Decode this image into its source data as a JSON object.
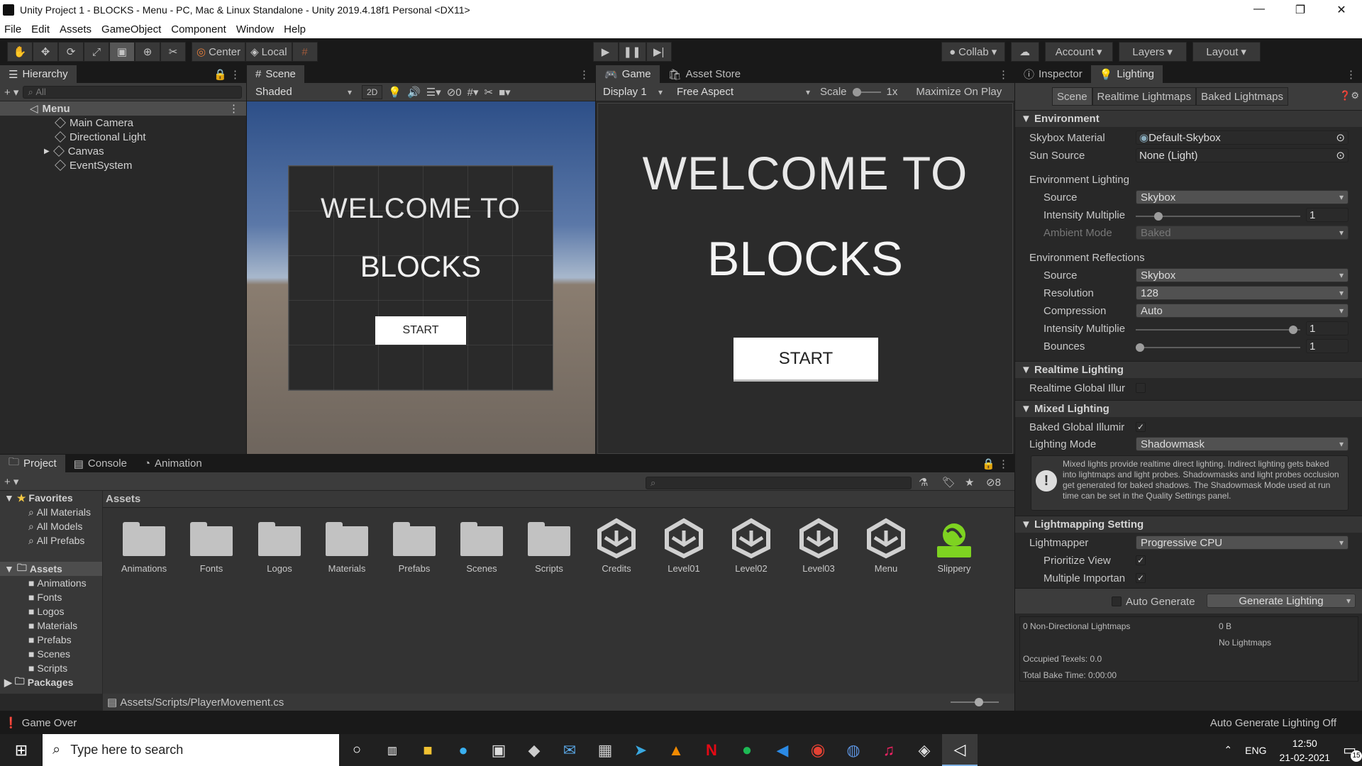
{
  "window": {
    "title": "Unity Project 1 - BLOCKS - Menu - PC, Mac & Linux Standalone - Unity 2019.4.18f1 Personal <DX11>"
  },
  "menu": [
    "File",
    "Edit",
    "Assets",
    "GameObject",
    "Component",
    "Window",
    "Help"
  ],
  "toolbar": {
    "center_label": "Center",
    "local_label": "Local",
    "collab_label": "Collab",
    "account_label": "Account",
    "layers_label": "Layers",
    "layout_label": "Layout"
  },
  "hierarchy": {
    "tab": "Hierarchy",
    "search_placeholder": "All",
    "scene": "Menu",
    "items": [
      "Main Camera",
      "Directional Light",
      "Canvas",
      "EventSystem"
    ]
  },
  "scene_view": {
    "tab": "Scene",
    "shading": "Shaded",
    "mode_2d": "2D",
    "hidden_count": "0",
    "welcome": "WELCOME TO",
    "title": "BLOCKS",
    "button": "START"
  },
  "game_view": {
    "tab": "Game",
    "asset_store_tab": "Asset Store",
    "display": "Display 1",
    "aspect": "Free Aspect",
    "scale_label": "Scale",
    "scale_value": "1x",
    "maximize": "Maximize On Play",
    "welcome": "WELCOME TO",
    "title": "BLOCKS",
    "button": "START"
  },
  "inspector": {
    "tab_inspector": "Inspector",
    "tab_lighting": "Lighting",
    "subtabs": [
      "Scene",
      "Realtime Lightmaps",
      "Baked Lightmaps"
    ],
    "environment": {
      "header": "Environment",
      "skybox_label": "Skybox Material",
      "skybox_value": "Default-Skybox",
      "sun_label": "Sun Source",
      "sun_value": "None (Light)",
      "env_lighting": "Environment Lighting",
      "source_label": "Source",
      "source_value": "Skybox",
      "intensity_label": "Intensity Multiplie",
      "intensity_value": "1",
      "ambient_label": "Ambient Mode",
      "ambient_value": "Baked",
      "env_reflections": "Environment Reflections",
      "refl_source_label": "Source",
      "refl_source_value": "Skybox",
      "resolution_label": "Resolution",
      "resolution_value": "128",
      "compression_label": "Compression",
      "compression_value": "Auto",
      "refl_intensity_label": "Intensity Multiplie",
      "refl_intensity_value": "1",
      "bounces_label": "Bounces",
      "bounces_value": "1"
    },
    "realtime": {
      "header": "Realtime Lighting",
      "gi_label": "Realtime Global Illur"
    },
    "mixed": {
      "header": "Mixed Lighting",
      "baked_label": "Baked Global Illumir",
      "mode_label": "Lighting Mode",
      "mode_value": "Shadowmask",
      "info": "Mixed lights provide realtime direct lighting. Indirect lighting gets baked into lightmaps and light probes. Shadowmasks and light probes occlusion get generated for baked shadows. The Shadowmask Mode used at run time can be set in the Quality Settings panel."
    },
    "lightmapping": {
      "header": "Lightmapping Setting",
      "lightmapper_label": "Lightmapper",
      "lightmapper_value": "Progressive CPU",
      "prioritize_label": "Prioritize View",
      "multiple_label": "Multiple Importan"
    },
    "auto_generate": "Auto Generate",
    "generate_button": "Generate Lighting",
    "stats": {
      "lightmaps": "0 Non-Directional Lightmaps",
      "size": "0 B",
      "no_lightmaps": "No Lightmaps",
      "texels": "Occupied Texels: 0.0",
      "bake_time": "Total Bake Time: 0:00:00"
    }
  },
  "project": {
    "tabs": [
      "Project",
      "Console",
      "Animation"
    ],
    "hidden_count": "8",
    "favorites": "Favorites",
    "fav_items": [
      "All Materials",
      "All Models",
      "All Prefabs"
    ],
    "assets_label": "Assets",
    "folders": [
      "Animations",
      "Fonts",
      "Logos",
      "Materials",
      "Prefabs",
      "Scenes",
      "Scripts"
    ],
    "packages": "Packages",
    "header": "Assets",
    "grid_folders": [
      "Animations",
      "Fonts",
      "Logos",
      "Materials",
      "Prefabs",
      "Scenes",
      "Scripts"
    ],
    "grid_scenes": [
      "Credits",
      "Level01",
      "Level02",
      "Level03",
      "Menu"
    ],
    "grid_material": "Slippery",
    "path": "Assets/Scripts/PlayerMovement.cs"
  },
  "status": {
    "left": "Game Over",
    "right": "Auto Generate Lighting Off"
  },
  "taskbar": {
    "search_placeholder": "Type here to search",
    "lang": "ENG",
    "time": "12:50",
    "date": "21-02-2021",
    "notif_count": "15"
  },
  "colors": {
    "accent_green": "#7ed321",
    "selection": "#4d4d4d",
    "active_subtab": "#4a4a4a"
  }
}
